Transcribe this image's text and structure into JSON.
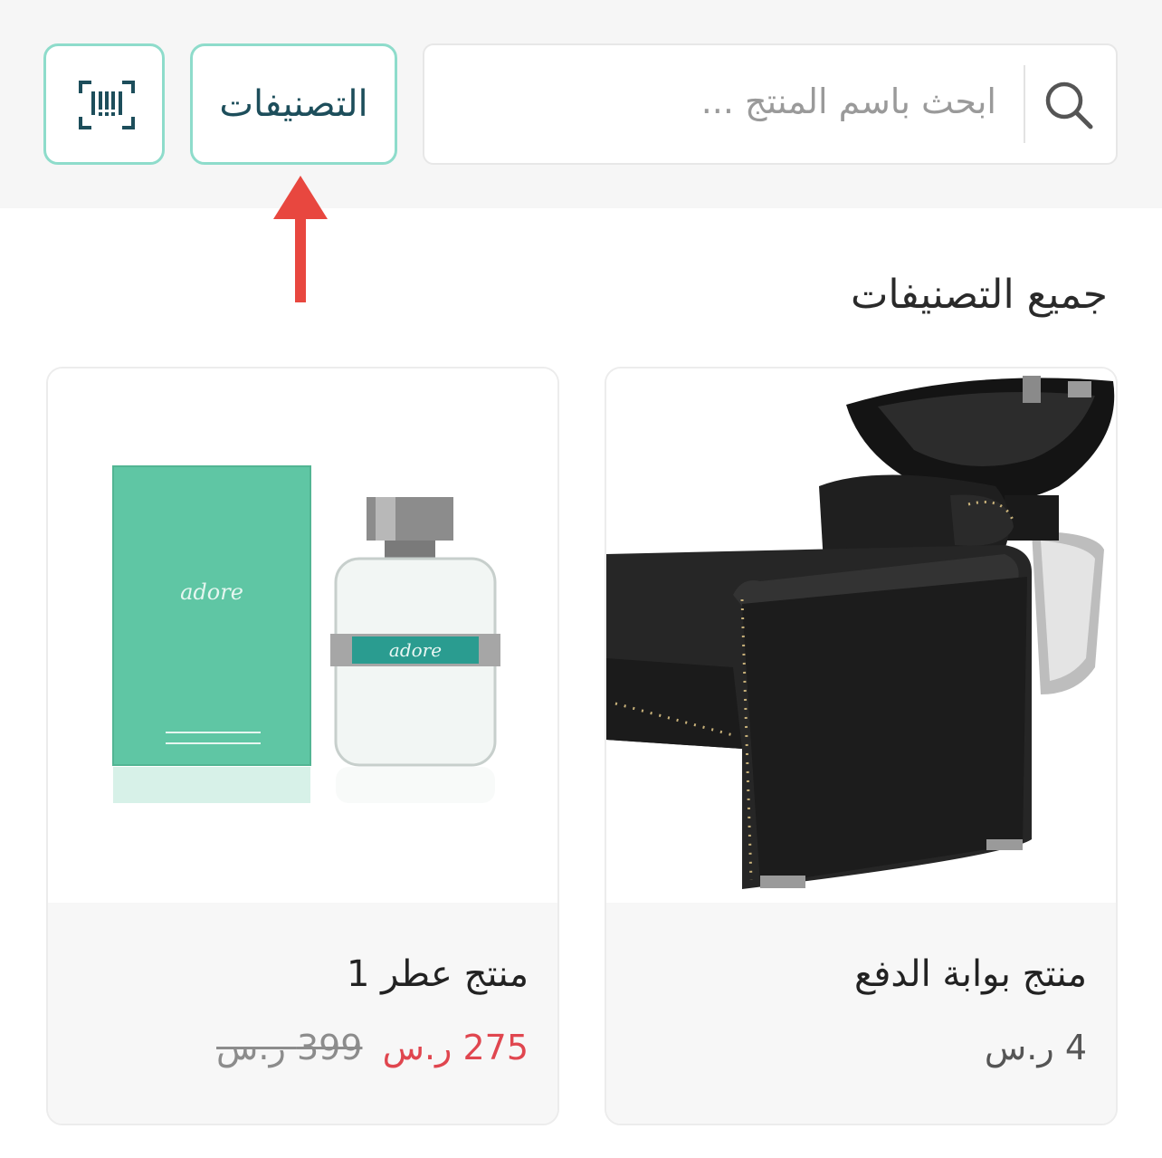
{
  "search": {
    "placeholder": "ابحث باسم المنتج ..."
  },
  "header": {
    "categories_label": "التصنيفات"
  },
  "section": {
    "title": "جميع التصنيفات"
  },
  "products": [
    {
      "name": "منتج بوابة الدفع",
      "price": "4 ر.س"
    },
    {
      "name": "منتج عطر 1",
      "sale_price": "275 ر.س",
      "old_price": "399 ر.س",
      "image_text": "adore"
    }
  ],
  "colors": {
    "accent_border": "#8edccb",
    "brand_text": "#1d4e5b",
    "sale_red": "#e0464f",
    "arrow_red": "#e8473f"
  }
}
